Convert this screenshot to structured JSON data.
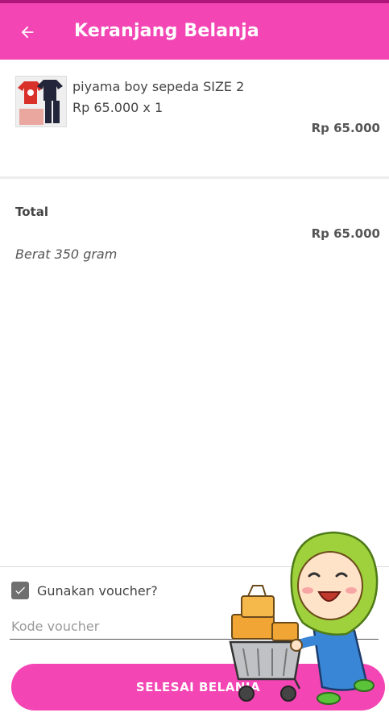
{
  "app_bar": {
    "title": "Keranjang Belanja",
    "back_icon": "arrow-left-icon",
    "background": "#f346b4"
  },
  "cart": {
    "items": [
      {
        "name": "piyama boy sepeda SIZE 2",
        "price_qty": "Rp 65.000 x 1",
        "subtotal": "Rp 65.000"
      }
    ]
  },
  "summary": {
    "total_label": "Total",
    "total_value": "Rp 65.000",
    "weight": "Berat 350 gram"
  },
  "voucher": {
    "checkbox_label": "Gunakan voucher?",
    "checked": true,
    "input_placeholder": "Kode voucher",
    "input_value": ""
  },
  "actions": {
    "finish_label": "SELESAI BELANJA"
  },
  "colors": {
    "accent": "#f346b4",
    "text": "#444444"
  }
}
